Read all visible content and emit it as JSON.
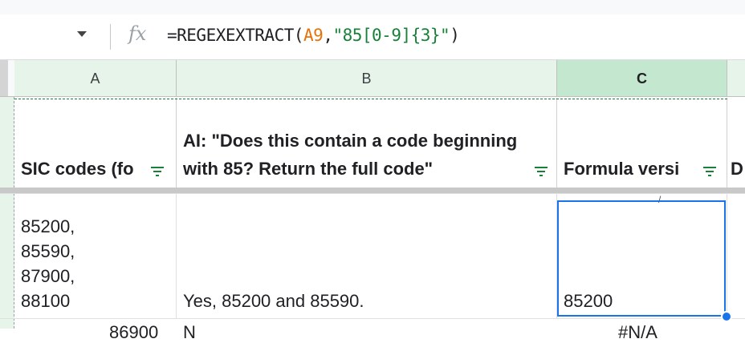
{
  "formula_bar": {
    "fx_label": "fx",
    "formula_prefix": "=REGEXEXTRACT(",
    "formula_ref": "A9",
    "formula_sep": ",",
    "formula_string": "\"85[0-9]{3}\"",
    "formula_suffix": ")"
  },
  "columns": [
    "A",
    "B",
    "C",
    "D"
  ],
  "header_row": {
    "a": "SIC codes (fo",
    "b": "AI: \"Does this contain a code beginning with 85? Return the full code\"",
    "c": "Formula versi",
    "d": "D"
  },
  "row": {
    "a": "85200,\n85590,\n87900,\n88100",
    "b": "Yes, 85200 and 85590.",
    "c": "85200"
  },
  "next_row_peek": {
    "a": "86900",
    "b": "N",
    "c": "#N/A"
  },
  "colors": {
    "selection": "#1a73e8",
    "header_selected": "#c4e7cf",
    "header_bg": "#e6f4ea",
    "filter_icon": "#188038"
  }
}
